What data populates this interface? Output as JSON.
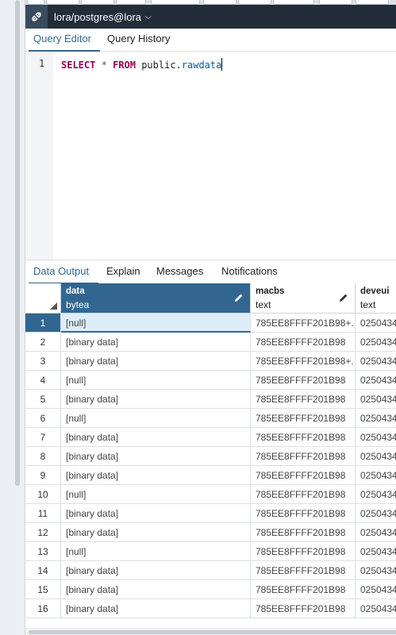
{
  "connection": {
    "label": "lora/postgres@lora",
    "icon": "plug-icon"
  },
  "editor_tabs": [
    {
      "label": "Query Editor",
      "active": true
    },
    {
      "label": "Query History",
      "active": false
    }
  ],
  "editor": {
    "line_number": "1",
    "sql": {
      "select": "SELECT",
      "star": "*",
      "from": "FROM",
      "schema": "public.",
      "table": "rawdata"
    }
  },
  "output_tabs": [
    {
      "label": "Data Output",
      "active": true
    },
    {
      "label": "Explain",
      "active": false
    },
    {
      "label": "Messages",
      "active": false
    },
    {
      "label": "Notifications",
      "active": false
    }
  ],
  "grid": {
    "columns": [
      {
        "name": "data",
        "type": "bytea",
        "selected": true
      },
      {
        "name": "macbs",
        "type": "text",
        "selected": false
      },
      {
        "name": "deveui",
        "type": "text",
        "selected": false
      }
    ],
    "rows": [
      {
        "num": "1",
        "data": "[null]",
        "macbs": "785EE8FFFF201B98+...",
        "deveui": "0250434"
      },
      {
        "num": "2",
        "data": "[binary data]",
        "macbs": "785EE8FFFF201B98",
        "deveui": "0250434"
      },
      {
        "num": "3",
        "data": "[binary data]",
        "macbs": "785EE8FFFF201B98+...",
        "deveui": "0250434"
      },
      {
        "num": "4",
        "data": "[null]",
        "macbs": "785EE8FFFF201B98",
        "deveui": "0250434"
      },
      {
        "num": "5",
        "data": "[binary data]",
        "macbs": "785EE8FFFF201B98",
        "deveui": "0250434"
      },
      {
        "num": "6",
        "data": "[null]",
        "macbs": "785EE8FFFF201B98",
        "deveui": "0250434"
      },
      {
        "num": "7",
        "data": "[binary data]",
        "macbs": "785EE8FFFF201B98",
        "deveui": "0250434"
      },
      {
        "num": "8",
        "data": "[binary data]",
        "macbs": "785EE8FFFF201B98",
        "deveui": "0250434"
      },
      {
        "num": "9",
        "data": "[binary data]",
        "macbs": "785EE8FFFF201B98",
        "deveui": "0250434"
      },
      {
        "num": "10",
        "data": "[null]",
        "macbs": "785EE8FFFF201B98",
        "deveui": "0250434"
      },
      {
        "num": "11",
        "data": "[binary data]",
        "macbs": "785EE8FFFF201B98",
        "deveui": "0250434"
      },
      {
        "num": "12",
        "data": "[binary data]",
        "macbs": "785EE8FFFF201B98",
        "deveui": "0250434"
      },
      {
        "num": "13",
        "data": "[null]",
        "macbs": "785EE8FFFF201B98",
        "deveui": "0250434"
      },
      {
        "num": "14",
        "data": "[binary data]",
        "macbs": "785EE8FFFF201B98",
        "deveui": "0250434"
      },
      {
        "num": "15",
        "data": "[binary data]",
        "macbs": "785EE8FFFF201B98",
        "deveui": "0250434"
      },
      {
        "num": "16",
        "data": "[binary data]",
        "macbs": "785EE8FFFF201B98",
        "deveui": "0250434"
      }
    ],
    "selected_row": 1
  },
  "colors": {
    "connbar_bg": "#222d3a",
    "accent": "#326690",
    "header_selected_bg": "#326690",
    "selected_row_bg": "#d6eaf8",
    "selected_cell_bg": "#dcedfa"
  }
}
